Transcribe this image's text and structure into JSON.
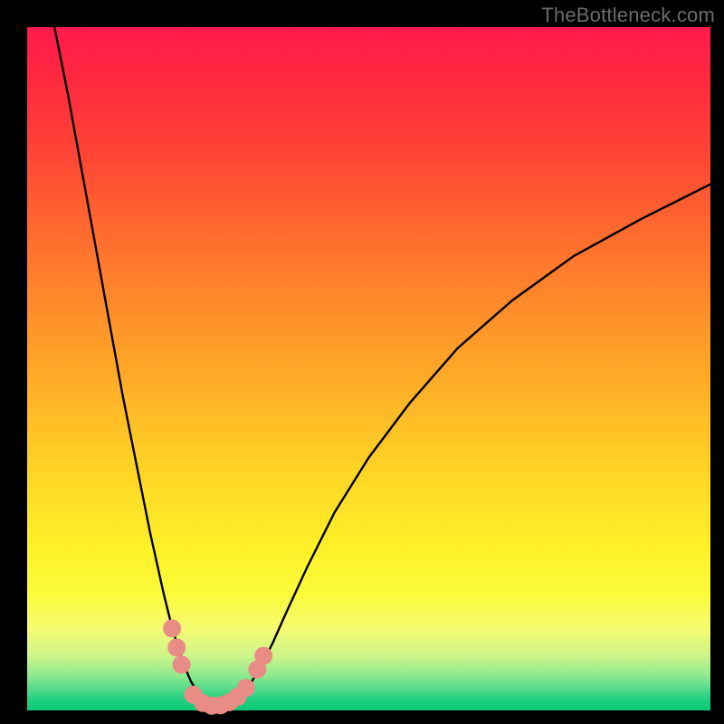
{
  "watermark": "TheBottleneck.com",
  "chart_data": {
    "type": "line",
    "title": "",
    "xlabel": "",
    "ylabel": "",
    "xlim": [
      0,
      100
    ],
    "ylim": [
      0,
      100
    ],
    "series": [
      {
        "name": "curve",
        "x": [
          4,
          6,
          8,
          10,
          12,
          14,
          16,
          18,
          20,
          21,
          22,
          23,
          24,
          25,
          26,
          27,
          28,
          29,
          30,
          31,
          32,
          34,
          36,
          38,
          41,
          45,
          50,
          56,
          63,
          71,
          80,
          90,
          100
        ],
        "y": [
          100,
          90,
          79,
          68,
          57,
          46,
          36,
          26,
          17,
          13,
          9.5,
          6.5,
          4.2,
          2.5,
          1.4,
          0.9,
          0.7,
          0.8,
          1.1,
          1.8,
          2.9,
          6.0,
          10,
          14.5,
          21,
          29,
          37,
          45,
          53,
          60,
          66.5,
          72,
          77
        ]
      }
    ],
    "markers": [
      {
        "x": 21.2,
        "y": 12.0
      },
      {
        "x": 21.9,
        "y": 9.2
      },
      {
        "x": 22.6,
        "y": 6.7
      },
      {
        "x": 24.3,
        "y": 2.3
      },
      {
        "x": 25.7,
        "y": 1.1
      },
      {
        "x": 27.0,
        "y": 0.7
      },
      {
        "x": 28.3,
        "y": 0.75
      },
      {
        "x": 29.6,
        "y": 1.2
      },
      {
        "x": 30.8,
        "y": 2.0
      },
      {
        "x": 32.0,
        "y": 3.3
      },
      {
        "x": 33.7,
        "y": 6.0
      },
      {
        "x": 34.6,
        "y": 8.0
      }
    ],
    "colors": {
      "curve": "#000000",
      "marker": "#e98c85",
      "gradient_top": "#ff1a4d",
      "gradient_bottom": "#0fc979"
    }
  }
}
